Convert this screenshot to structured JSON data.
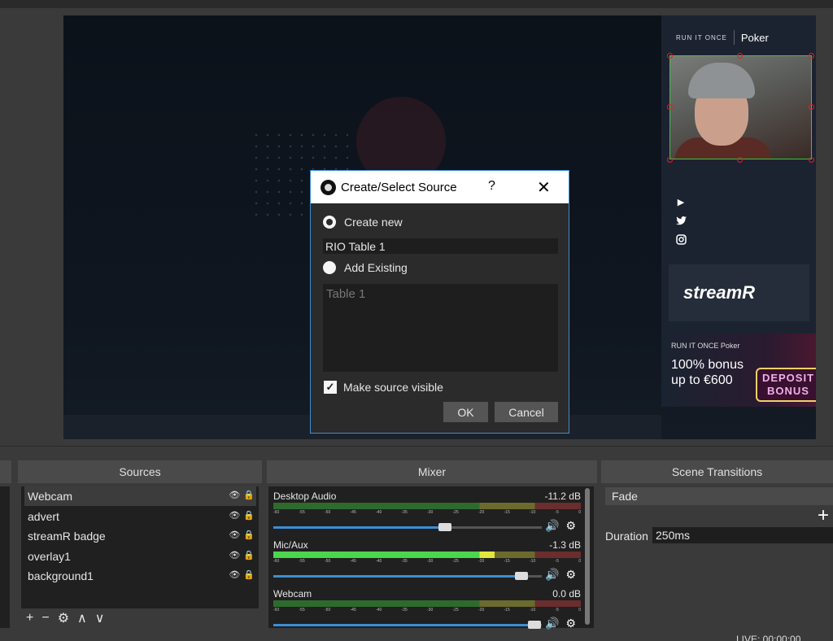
{
  "dialog": {
    "title": "Create/Select Source",
    "help": "?",
    "close": "✕",
    "create_new_label": "Create new",
    "source_name": "RIO Table 1",
    "add_existing_label": "Add Existing",
    "existing_items": [
      "Table 1"
    ],
    "visible_label": "Make source visible",
    "visible_checked": true,
    "ok_label": "OK",
    "cancel_label": "Cancel"
  },
  "overlay": {
    "brand": "RUN IT ONCE",
    "brand_poker": "Poker",
    "streamr": "streamR",
    "promo_brand": "RUN IT ONCE",
    "promo_poker": "Poker",
    "promo_line1": "100% bonus",
    "promo_line2": "up to €600",
    "promo_badge_1": "DEPOSIT",
    "promo_badge_2": "BONUS"
  },
  "sources": {
    "header": "Sources",
    "items": [
      "Webcam",
      "advert",
      "streamR badge",
      "overlay1",
      "background1"
    ],
    "selected_index": 0
  },
  "mixer": {
    "header": "Mixer",
    "channels": [
      {
        "name": "Desktop Audio",
        "db": "-11.2 dB",
        "level": 0.56
      },
      {
        "name": "Mic/Aux",
        "db": "-1.3 dB",
        "level": 0.86
      },
      {
        "name": "Webcam",
        "db": "0.0 dB",
        "level": 0.93
      }
    ],
    "ticks": [
      "-60",
      "-55",
      "-50",
      "-45",
      "-40",
      "-35",
      "-30",
      "-25",
      "-20",
      "-15",
      "-10",
      "-5",
      "0"
    ]
  },
  "transitions": {
    "header": "Scene Transitions",
    "selected": "Fade",
    "duration_label": "Duration",
    "duration_value": "250ms"
  },
  "status": {
    "live": "LIVE: 00:00:00"
  },
  "colors": {
    "accent": "#3c8ed4",
    "selection_green": "#2ecc40",
    "handle_red": "#e02020"
  }
}
